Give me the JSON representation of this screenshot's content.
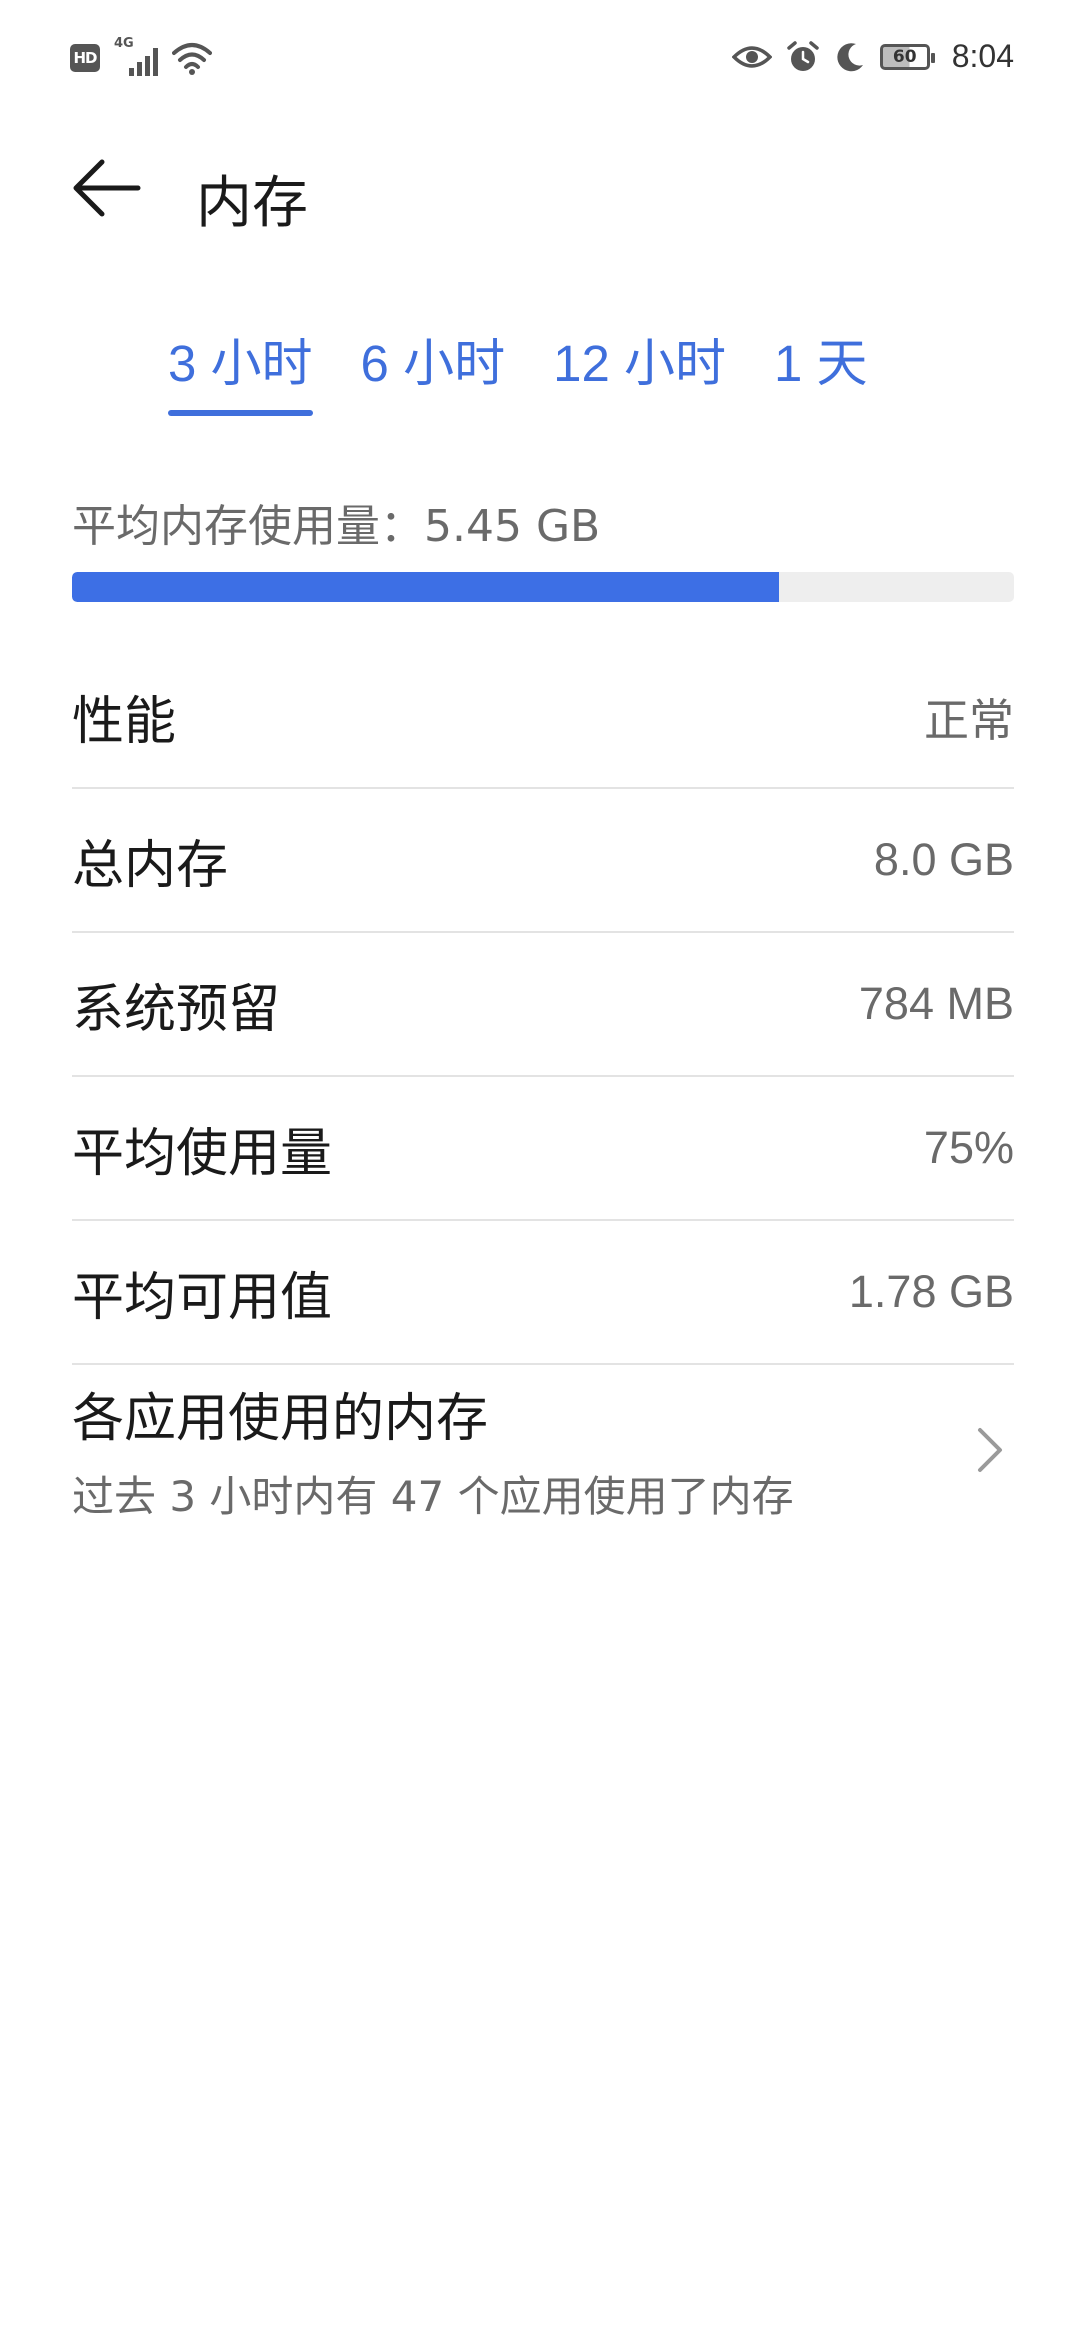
{
  "status_bar": {
    "hd": "HD",
    "network": "4G",
    "battery": "60",
    "time": "8:04"
  },
  "header": {
    "title": "内存"
  },
  "tabs": [
    {
      "label": "3 小时",
      "active": true
    },
    {
      "label": "6 小时",
      "active": false
    },
    {
      "label": "12 小时",
      "active": false
    },
    {
      "label": "1 天",
      "active": false
    }
  ],
  "average": {
    "label": "平均内存使用量：5.45 GB",
    "usage_fraction": 0.75
  },
  "rows": [
    {
      "label": "性能",
      "value": "正常"
    },
    {
      "label": "总内存",
      "value": "8.0 GB"
    },
    {
      "label": "系统预留",
      "value": "784 MB"
    },
    {
      "label": "平均使用量",
      "value": "75%"
    },
    {
      "label": "平均可用值",
      "value": "1.78 GB"
    }
  ],
  "apps_entry": {
    "title": "各应用使用的内存",
    "subtitle": "过去 3 小时内有 47 个应用使用了内存"
  },
  "colors": {
    "accent": "#3f6fdc",
    "progress_fill": "#3d6fe5",
    "progress_track": "#eeeeee"
  }
}
